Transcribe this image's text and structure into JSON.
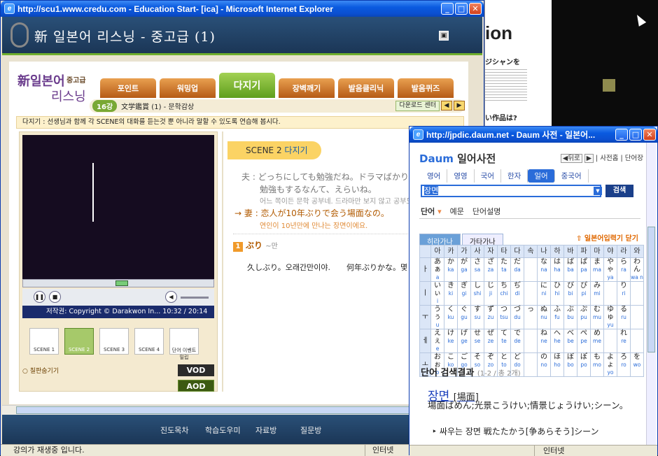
{
  "main_window": {
    "title": "http://scu1.www.credu.com - Education Start- [ica] - Microsoft Internet Explorer",
    "header_title": "新 일본어 리스닝 - 중고급 (1)",
    "course_logo_1": "新일본어",
    "course_logo_2": "리스닝",
    "level": "중고급",
    "tabs": [
      "포인트",
      "워밍업",
      "다지기",
      "장벽깨기",
      "발음클리닉",
      "발음퀴즈"
    ],
    "lesson_num": "16강",
    "lesson_title": "文学鑑賞 (1) - 문학감상",
    "download": "다운로드 센터",
    "instruction": "다지기 : 선생님과 함께 각 SCENE의 대화를 듣는것 뿐 아니라 말할 수 있도록 연습해 봅시다.",
    "copyright": "저작권: Copyright © Darakwon In... 10:32 / 20:14",
    "scenes": [
      "SCENE 1",
      "SCENE 2",
      "SCENE 3",
      "SCENE 4",
      "단어 이벤트 밀립"
    ],
    "hint": "칠판숨기기",
    "vod": "VOD",
    "aod": "AOD",
    "scene_title_a": "SCENE 2",
    "scene_title_b": "다지기",
    "dialog": {
      "line1": "夫 : どっちにしても勉強だね。ドラマばかり見",
      "line1b": "勉強もするなんて、えらいね。",
      "line1_ko": "어느 쪽이든 문학 공부네. 드라마만 보지 않고 공부도",
      "line2": "妻 : 恋人が10年ぶりで会う場面なの。",
      "line2_ko": "연인이 10년만에 만나는 장면이에요."
    },
    "vocab_num": "1",
    "vocab_word": "ぶり",
    "vocab_gloss": "~만",
    "vocab_ex": "久しぶり。오래간만이야.",
    "vocab_ex2": "何年ぶりかな。몇",
    "footer": [
      "진도목차",
      "학습도우미",
      "자료방",
      "질문방"
    ],
    "status": "강의가 재생중 입니다.",
    "zone": "인터넷"
  },
  "dict_window": {
    "title": "http://jpdic.daum.net - Daum 사전 - 일본어...",
    "logo": "Daum",
    "logo_suffix": "일어사전",
    "nav": [
      "뒤로",
      "사전홈",
      "단어장"
    ],
    "lang_tabs": [
      "영어",
      "영영",
      "국어",
      "한자",
      "일어",
      "중국어"
    ],
    "search_value": "장면",
    "search_btn": "검색",
    "sub_tabs": [
      "단어",
      "예문",
      "단어설명"
    ],
    "kana_tabs": [
      "히라가나",
      "가타가나"
    ],
    "keyboard_close": "일본어입력기 닫기",
    "kana_header": [
      "아",
      "카",
      "가",
      "사",
      "자",
      "타",
      "다",
      "속",
      "나",
      "하",
      "바",
      "파",
      "마",
      "야",
      "라",
      "와"
    ],
    "kana_rows": [
      {
        "h": "ㅏ",
        "c": [
          [
            "あぁ",
            "a"
          ],
          [
            "か",
            "ka"
          ],
          [
            "が",
            "ga"
          ],
          [
            "さ",
            "sa"
          ],
          [
            "ざ",
            "za"
          ],
          [
            "た",
            "ta"
          ],
          [
            "だ",
            "da"
          ],
          [
            "",
            ""
          ],
          [
            "な",
            "na"
          ],
          [
            "は",
            "ha"
          ],
          [
            "ば",
            "ba"
          ],
          [
            "ぱ",
            "pa"
          ],
          [
            "ま",
            "ma"
          ],
          [
            "やゃ",
            "ya"
          ],
          [
            "ら",
            "ra"
          ],
          [
            "わん",
            "wa n"
          ]
        ]
      },
      {
        "h": "ㅣ",
        "c": [
          [
            "いぃ",
            "i"
          ],
          [
            "き",
            "ki"
          ],
          [
            "ぎ",
            "gi"
          ],
          [
            "し",
            "shi"
          ],
          [
            "じ",
            "ji"
          ],
          [
            "ち",
            "chi"
          ],
          [
            "ぢ",
            "di"
          ],
          [
            "",
            ""
          ],
          [
            "に",
            "ni"
          ],
          [
            "ひ",
            "hi"
          ],
          [
            "び",
            "bi"
          ],
          [
            "ぴ",
            "pi"
          ],
          [
            "み",
            "mi"
          ],
          [
            "",
            ""
          ],
          [
            "り",
            "ri"
          ],
          [
            "",
            ""
          ]
        ]
      },
      {
        "h": "ㅜ",
        "c": [
          [
            "うぅ",
            "u"
          ],
          [
            "く",
            "ku"
          ],
          [
            "ぐ",
            "gu"
          ],
          [
            "す",
            "su"
          ],
          [
            "ず",
            "zu"
          ],
          [
            "つ",
            "tsu"
          ],
          [
            "づ",
            "du"
          ],
          [
            "っ",
            ""
          ],
          [
            "ぬ",
            "nu"
          ],
          [
            "ふ",
            "fu"
          ],
          [
            "ぶ",
            "bu"
          ],
          [
            "ぷ",
            "pu"
          ],
          [
            "む",
            "mu"
          ],
          [
            "ゆゅ",
            "yu"
          ],
          [
            "る",
            "ru"
          ],
          [
            "",
            ""
          ]
        ]
      },
      {
        "h": "ㅔ",
        "c": [
          [
            "えぇ",
            "e"
          ],
          [
            "け",
            "ke"
          ],
          [
            "げ",
            "ge"
          ],
          [
            "せ",
            "se"
          ],
          [
            "ぜ",
            "ze"
          ],
          [
            "て",
            "te"
          ],
          [
            "で",
            "de"
          ],
          [
            "",
            ""
          ],
          [
            "ね",
            "ne"
          ],
          [
            "へ",
            "he"
          ],
          [
            "べ",
            "be"
          ],
          [
            "ぺ",
            "pe"
          ],
          [
            "め",
            "me"
          ],
          [
            "",
            ""
          ],
          [
            "れ",
            "re"
          ],
          [
            "",
            ""
          ]
        ]
      },
      {
        "h": "ㅗ",
        "c": [
          [
            "おぉ",
            "o"
          ],
          [
            "こ",
            "ko"
          ],
          [
            "ご",
            "go"
          ],
          [
            "そ",
            "so"
          ],
          [
            "ぞ",
            "zo"
          ],
          [
            "と",
            "to"
          ],
          [
            "ど",
            "do"
          ],
          [
            "",
            ""
          ],
          [
            "の",
            "no"
          ],
          [
            "ほ",
            "ho"
          ],
          [
            "ぼ",
            "bo"
          ],
          [
            "ぽ",
            "po"
          ],
          [
            "も",
            "mo"
          ],
          [
            "よょ",
            "yo"
          ],
          [
            "ろ",
            "ro"
          ],
          [
            "を",
            "wo"
          ]
        ]
      }
    ],
    "results_title": "단어 검색결과",
    "results_count": "(1-2 / 총 2개)",
    "entry_word": "장면",
    "entry_hanja": "[場面]",
    "entry_def": "場面ばめん;光景こうけい;情景じょうけい;シーン。",
    "example": "싸우는 장면 戦たたかう[争あらそう]シーン",
    "status": "",
    "zone": "인터넷"
  },
  "bg_window": {
    "frag1": "ion",
    "frag2": "ジシャンを",
    "frag3": "い作品は?"
  }
}
